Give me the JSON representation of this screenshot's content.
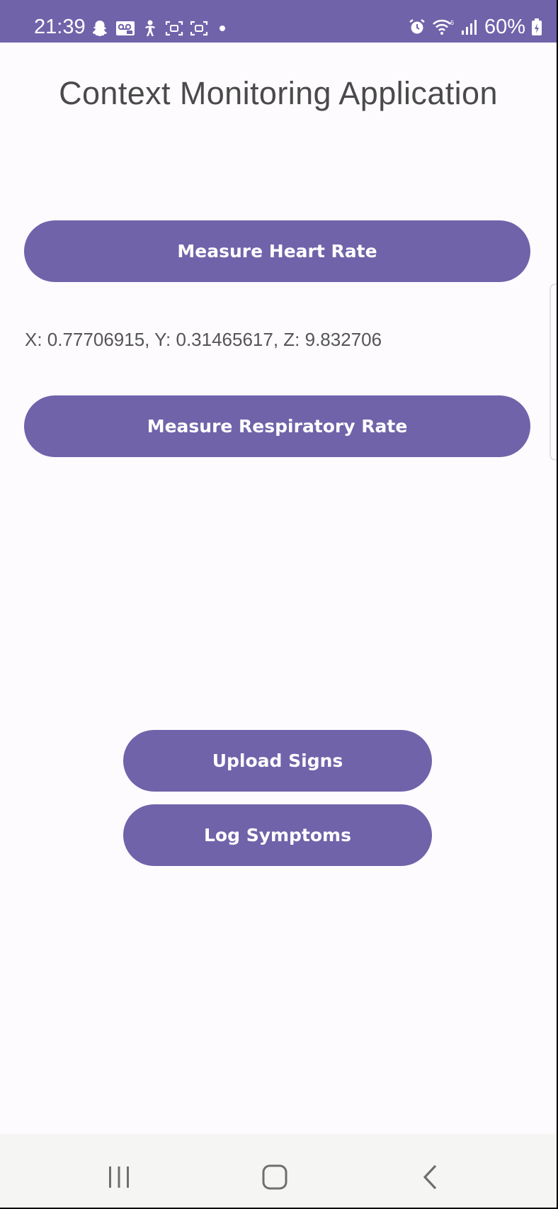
{
  "status_bar": {
    "time": "21:39",
    "battery": "60%",
    "background_color": "#7063aa",
    "left_icons": [
      "snapchat-icon",
      "voicemail-icon",
      "user-accessibility-icon",
      "screenshot-icon",
      "screenshot-icon",
      "dot-icon"
    ],
    "right_icons": [
      "alarm-icon",
      "wifi-icon",
      "signal-icon",
      "battery-icon"
    ]
  },
  "app": {
    "title": "Context Monitoring Application",
    "accent_color": "#7063aa"
  },
  "buttons": {
    "heart_rate": "Measure Heart Rate",
    "respiratory_rate": "Measure Respiratory Rate",
    "upload_signs": "Upload Signs",
    "log_symptoms": "Log Symptoms"
  },
  "accelerometer": {
    "readout": "X: 0.77706915, Y: 0.31465617, Z: 9.832706"
  },
  "nav_bar": {
    "icons": [
      "recents-icon",
      "home-icon",
      "back-icon"
    ]
  }
}
